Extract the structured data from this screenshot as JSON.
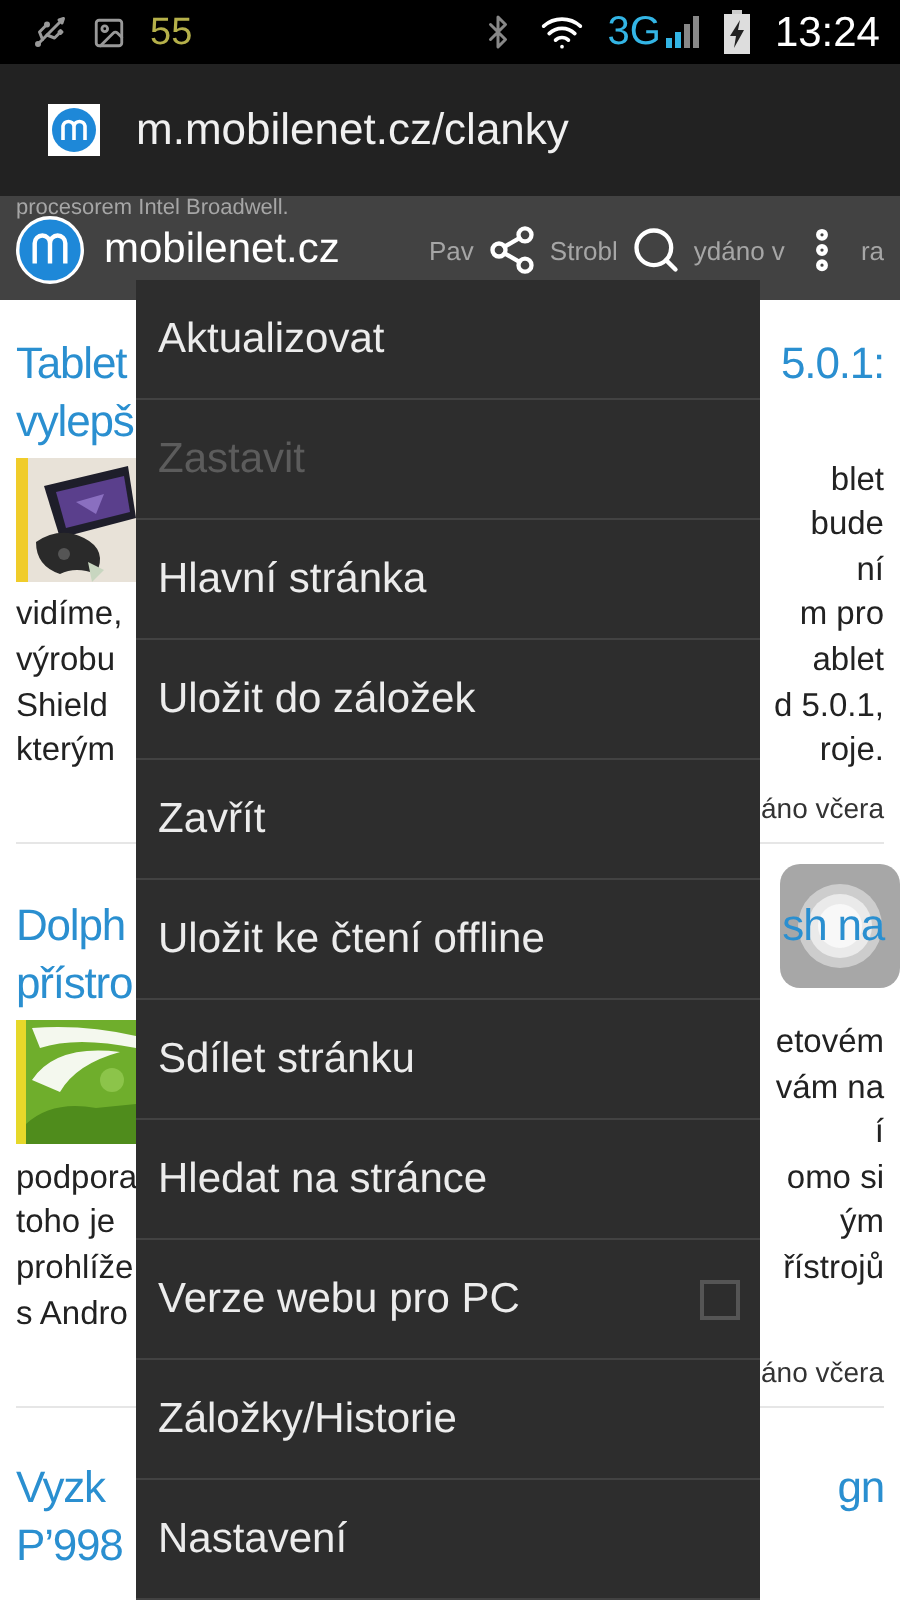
{
  "status_bar": {
    "notification_count": "55",
    "network": "3G",
    "time": "13:24"
  },
  "url_bar": {
    "url": "m.mobilenet.cz/clanky"
  },
  "site_header": {
    "title": "mobilenet.cz",
    "behind_line": "procesorem Intel Broadwell.",
    "behind_byline": [
      "Pav",
      "Strobl",
      "ydáno v",
      "ra"
    ]
  },
  "articles": [
    {
      "title_lines": [
        {
          "left": "Tablet",
          "right": "5.0.1:"
        },
        {
          "left": "vylepš"
        }
      ],
      "image_side_lines": [
        "blet",
        "bude",
        "ní"
      ],
      "body_lines": [
        {
          "left": "vidíme,",
          "right": "m pro"
        },
        {
          "left": "výrobu",
          "right": "ablet"
        },
        {
          "left": "Shield",
          "right": "d 5.0.1,"
        },
        {
          "left": "kterým",
          "right": "roje."
        }
      ],
      "byline": "áno včera"
    },
    {
      "title_lines": [
        {
          "left": "Dolph",
          "right": "sh na"
        },
        {
          "left": "přístro"
        }
      ],
      "image_side_lines": [
        "etovém",
        "vám na",
        "í"
      ],
      "body_lines": [
        {
          "left": "podpora",
          "right": "omo si"
        },
        {
          "left": "toho je",
          "right": "ým"
        },
        {
          "left": "prohlíže",
          "right": "řístrojů"
        },
        {
          "left": "s Andro"
        }
      ],
      "byline": "áno včera"
    },
    {
      "title_lines": [
        {
          "left": "Vyzk",
          "right": "gn"
        },
        {
          "left": "P’998"
        }
      ]
    }
  ],
  "menu": [
    {
      "label": "Aktualizovat",
      "kind": "plain",
      "disabled": false
    },
    {
      "label": "Zastavit",
      "kind": "plain",
      "disabled": true
    },
    {
      "label": "Hlavní stránka",
      "kind": "plain",
      "disabled": false
    },
    {
      "label": "Uložit do záložek",
      "kind": "plain",
      "disabled": false
    },
    {
      "label": "Zavřít",
      "kind": "plain",
      "disabled": false
    },
    {
      "label": "Uložit ke čtení offline",
      "kind": "plain",
      "disabled": false
    },
    {
      "label": "Sdílet stránku",
      "kind": "plain",
      "disabled": false
    },
    {
      "label": "Hledat na stránce",
      "kind": "plain",
      "disabled": false
    },
    {
      "label": "Verze webu pro PC",
      "kind": "checkbox",
      "disabled": false,
      "checked": false
    },
    {
      "label": "Záložky/Historie",
      "kind": "plain",
      "disabled": false
    },
    {
      "label": "Nastavení",
      "kind": "plain",
      "disabled": false
    }
  ]
}
